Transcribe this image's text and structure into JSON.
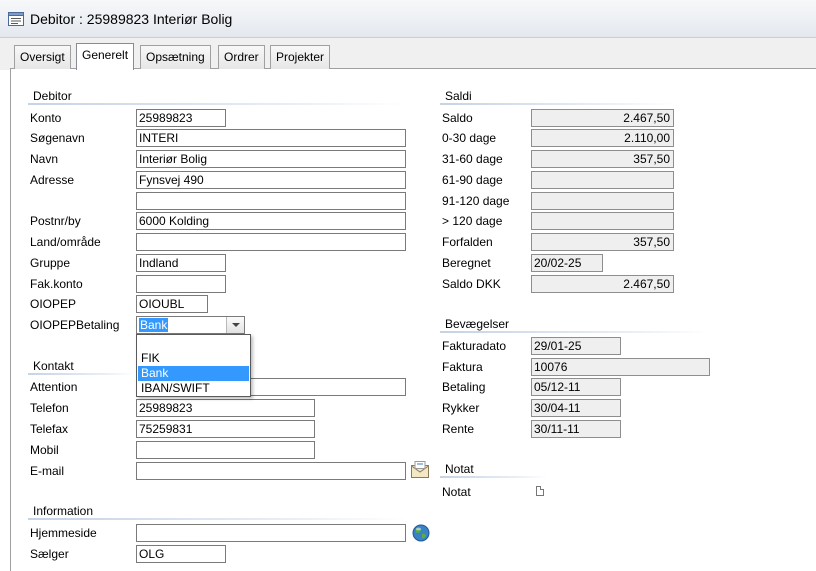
{
  "window": {
    "title": "Debitor : 25989823   Interiør Bolig"
  },
  "tabs": [
    {
      "label": "Oversigt"
    },
    {
      "label": "Generelt"
    },
    {
      "label": "Opsætning"
    },
    {
      "label": "Ordrer"
    },
    {
      "label": "Projekter"
    }
  ],
  "debitor": {
    "title": "Debitor",
    "konto_label": "Konto",
    "konto": "25989823",
    "sogenavn_label": "Søgenavn",
    "sogenavn": "INTERI",
    "navn_label": "Navn",
    "navn": "Interiør Bolig",
    "adresse_label": "Adresse",
    "adresse1": "Fynsvej 490",
    "adresse2": "",
    "postnr_label": "Postnr/by",
    "postnr": "6000  Kolding",
    "land_label": "Land/område",
    "land": "",
    "gruppe_label": "Gruppe",
    "gruppe": "Indland",
    "fakkonto_label": "Fak.konto",
    "fakkonto": "",
    "oiopep_label": "OIOPEP",
    "oiopep": "OIOUBL",
    "oiopepbetaling_label": "OIOPEPBetaling",
    "oiopepbetaling": "Bank",
    "betaling_options": [
      "",
      "FIK",
      "Bank",
      "IBAN/SWIFT"
    ]
  },
  "kontakt": {
    "title": "Kontakt",
    "attention_label": "Attention",
    "attention": "",
    "telefon_label": "Telefon",
    "telefon": "25989823",
    "telefax_label": "Telefax",
    "telefax": "75259831",
    "mobil_label": "Mobil",
    "mobil": "",
    "email_label": "E-mail",
    "email": ""
  },
  "information": {
    "title": "Information",
    "hjemmeside_label": "Hjemmeside",
    "hjemmeside": "",
    "saelger_label": "Sælger",
    "saelger": "OLG"
  },
  "saldi": {
    "title": "Saldi",
    "saldo_label": "Saldo",
    "saldo": "2.467,50",
    "d0_30_label": "0-30 dage",
    "d0_30": "2.110,00",
    "d31_60_label": "31-60 dage",
    "d31_60": "357,50",
    "d61_90_label": "61-90 dage",
    "d61_90": "",
    "d91_120_label": "91-120 dage",
    "d91_120": "",
    "d120_label": "> 120 dage",
    "d120": "",
    "forfalden_label": "Forfalden",
    "forfalden": "357,50",
    "beregnet_label": "Beregnet",
    "beregnet": "20/02-25",
    "saldo_dkk_label": "Saldo DKK",
    "saldo_dkk": "2.467,50"
  },
  "bevaegelser": {
    "title": "Bevægelser",
    "fakturadato_label": "Fakturadato",
    "fakturadato": "29/01-25",
    "faktura_label": "Faktura",
    "faktura": "10076",
    "betaling_label": "Betaling",
    "betaling": "05/12-11",
    "rykker_label": "Rykker",
    "rykker": "30/04-11",
    "rente_label": "Rente",
    "rente": "30/11-11"
  },
  "notat": {
    "title": "Notat",
    "notat_label": "Notat"
  },
  "icons": {
    "window": "form-icon",
    "email": "envelope-icon",
    "web": "globe-icon",
    "notat": "note-icon"
  },
  "colors": {
    "selection": "#3399ff",
    "readonly_bg": "#efefef",
    "section_line": "#c5d3e4"
  }
}
